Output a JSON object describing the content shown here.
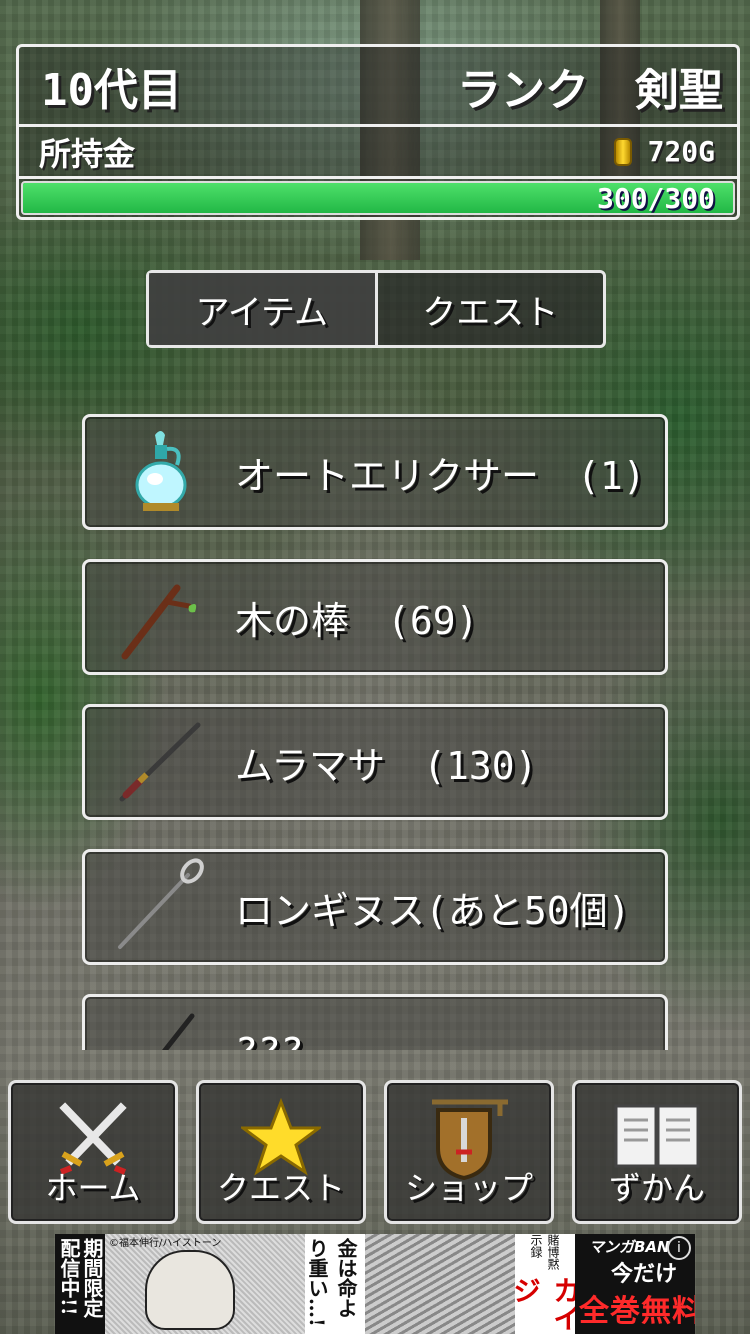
{
  "header": {
    "generation": "10代目",
    "rank_label": "ランク",
    "rank_value": "剣聖",
    "money_label": "所持金",
    "money_value": "720G",
    "hp_text": "300/300",
    "hp_fraction": 1.0
  },
  "tabs": [
    {
      "label": "アイテム",
      "active": true
    },
    {
      "label": "クエスト",
      "active": false
    }
  ],
  "items": [
    {
      "icon": "elixir-bottle-icon",
      "label": "オートエリクサー　(1)"
    },
    {
      "icon": "wooden-stick-icon",
      "label": "木の棒　(69)"
    },
    {
      "icon": "katana-icon",
      "label": "ムラマサ　(130)"
    },
    {
      "icon": "spear-icon",
      "label": "ロンギヌス(あと50個)"
    },
    {
      "icon": "sword-icon",
      "label": "???"
    }
  ],
  "nav": [
    {
      "icon": "crossed-swords-icon",
      "label": "ホーム"
    },
    {
      "icon": "star-icon",
      "label": "クエスト"
    },
    {
      "icon": "shop-sign-icon",
      "label": "ショップ"
    },
    {
      "icon": "book-icon",
      "label": "ずかん"
    }
  ],
  "ad": {
    "left_text": "期間限定配信中!!",
    "credit": "©福本伸行/ハイストーン",
    "speech": "金は命より重い…!",
    "sub": "賭博黙示録",
    "title": "カイジ",
    "brand": "マンガBAN",
    "info": "i",
    "now": "今だけ",
    "free": "全巻無料"
  },
  "colors": {
    "hp_green": "#22b846",
    "coin_gold": "#ffd930",
    "ad_red": "#d60000"
  }
}
